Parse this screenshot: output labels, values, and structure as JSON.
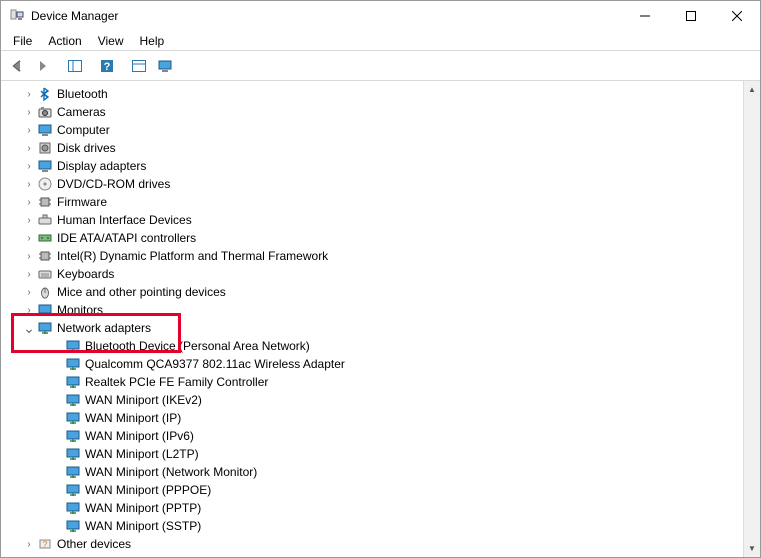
{
  "window": {
    "title": "Device Manager"
  },
  "menu": [
    "File",
    "Action",
    "View",
    "Help"
  ],
  "categories": [
    {
      "id": "bluetooth",
      "label": "Bluetooth",
      "icon": "bluetooth",
      "expanded": false
    },
    {
      "id": "cameras",
      "label": "Cameras",
      "icon": "camera",
      "expanded": false
    },
    {
      "id": "computer",
      "label": "Computer",
      "icon": "monitor-blue",
      "expanded": false
    },
    {
      "id": "disk",
      "label": "Disk drives",
      "icon": "disk",
      "expanded": false
    },
    {
      "id": "display",
      "label": "Display adapters",
      "icon": "monitor-blue",
      "expanded": false
    },
    {
      "id": "dvd",
      "label": "DVD/CD-ROM drives",
      "icon": "disc",
      "expanded": false
    },
    {
      "id": "firmware",
      "label": "Firmware",
      "icon": "chip",
      "expanded": false
    },
    {
      "id": "hid",
      "label": "Human Interface Devices",
      "icon": "hid",
      "expanded": false
    },
    {
      "id": "ide",
      "label": "IDE ATA/ATAPI controllers",
      "icon": "ide",
      "expanded": false
    },
    {
      "id": "intel",
      "label": "Intel(R) Dynamic Platform and Thermal Framework",
      "icon": "chip",
      "expanded": false
    },
    {
      "id": "keyboards",
      "label": "Keyboards",
      "icon": "keyboard",
      "expanded": false
    },
    {
      "id": "mice",
      "label": "Mice and other pointing devices",
      "icon": "mouse",
      "expanded": false
    },
    {
      "id": "monitors",
      "label": "Monitors",
      "icon": "monitor-blue",
      "expanded": false
    },
    {
      "id": "network",
      "label": "Network adapters",
      "icon": "network",
      "expanded": true,
      "children": [
        {
          "label": "Bluetooth Device (Personal Area Network)"
        },
        {
          "label": "Qualcomm QCA9377 802.11ac Wireless Adapter"
        },
        {
          "label": "Realtek PCIe FE Family Controller"
        },
        {
          "label": "WAN Miniport (IKEv2)"
        },
        {
          "label": "WAN Miniport (IP)"
        },
        {
          "label": "WAN Miniport (IPv6)"
        },
        {
          "label": "WAN Miniport (L2TP)"
        },
        {
          "label": "WAN Miniport (Network Monitor)"
        },
        {
          "label": "WAN Miniport (PPPOE)"
        },
        {
          "label": "WAN Miniport (PPTP)"
        },
        {
          "label": "WAN Miniport (SSTP)"
        }
      ]
    },
    {
      "id": "other",
      "label": "Other devices",
      "icon": "other",
      "expanded": false
    }
  ]
}
